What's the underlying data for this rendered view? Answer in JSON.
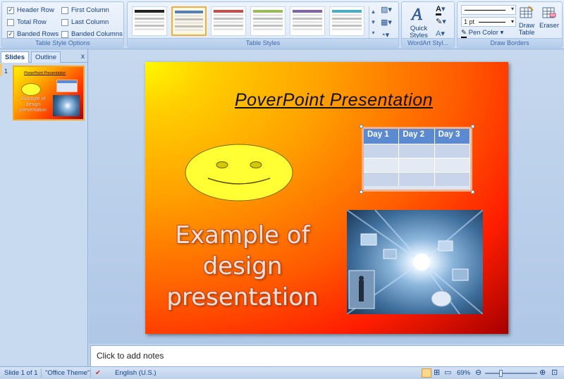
{
  "ribbon": {
    "table_style_options": {
      "label": "Table Style Options",
      "header_row": {
        "label": "Header Row",
        "checked": true
      },
      "total_row": {
        "label": "Total Row",
        "checked": false
      },
      "banded_rows": {
        "label": "Banded Rows",
        "checked": true
      },
      "first_column": {
        "label": "First Column",
        "checked": false
      },
      "last_column": {
        "label": "Last Column",
        "checked": false
      },
      "banded_columns": {
        "label": "Banded Columns",
        "checked": false
      }
    },
    "table_styles": {
      "label": "Table Styles",
      "colors": [
        "#222222",
        "#4f81bd",
        "#c0504d",
        "#9bbb59",
        "#8064a2",
        "#4bacc6"
      ]
    },
    "wordart_styles": {
      "label": "WordArt Styl...",
      "quick_styles": "Quick Styles"
    },
    "draw_borders": {
      "label": "Draw Borders",
      "pen_weight": "1 pt",
      "pen_color": "Pen Color",
      "draw_table": "Draw Table",
      "eraser": "Eraser"
    }
  },
  "left_panel": {
    "tab_slides": "Slides",
    "tab_outline": "Outline",
    "close": "x",
    "slide_number": "1"
  },
  "slide": {
    "title": "PoverPoint  Presentation",
    "table_headers": [
      "Day  1",
      "Day 2",
      "Day 3"
    ],
    "body_lines": [
      "Example of",
      "design",
      "presentation"
    ]
  },
  "notes_placeholder": "Click to add notes",
  "status": {
    "slide_count": "Slide 1 of 1",
    "theme": "\"Office Theme\"",
    "language": "English (U.S.)",
    "zoom": "69%"
  }
}
